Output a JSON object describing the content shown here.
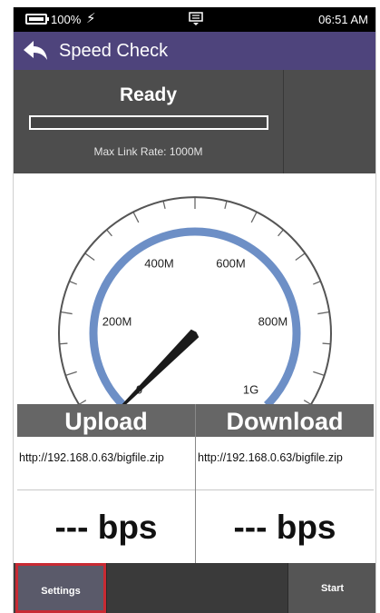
{
  "status_bar": {
    "battery_percent": "100%",
    "charging_icon": "lightning-bolt-icon",
    "notification_icon": "notification-tray-icon",
    "time": "06:51 AM"
  },
  "title_bar": {
    "back_icon": "back-arrow-icon",
    "title": "Speed Check"
  },
  "status_panel": {
    "state": "Ready",
    "progress_fraction": 0,
    "max_link_rate": "Max Link Rate: 1000M"
  },
  "gauge": {
    "labels": [
      "0",
      "200M",
      "400M",
      "600M",
      "800M",
      "1G"
    ],
    "max_mbps": 1000,
    "needle_value_mbps": 0,
    "arc_color": "#6d8fc6"
  },
  "results": {
    "upload": {
      "header": "Upload",
      "url": "http://192.168.0.63/bigfile.zip",
      "speed": "--- bps"
    },
    "download": {
      "header": "Download",
      "url": "http://192.168.0.63/bigfile.zip",
      "speed": "--- bps"
    }
  },
  "bottom_bar": {
    "settings_label": "Settings",
    "start_label": "Start"
  }
}
